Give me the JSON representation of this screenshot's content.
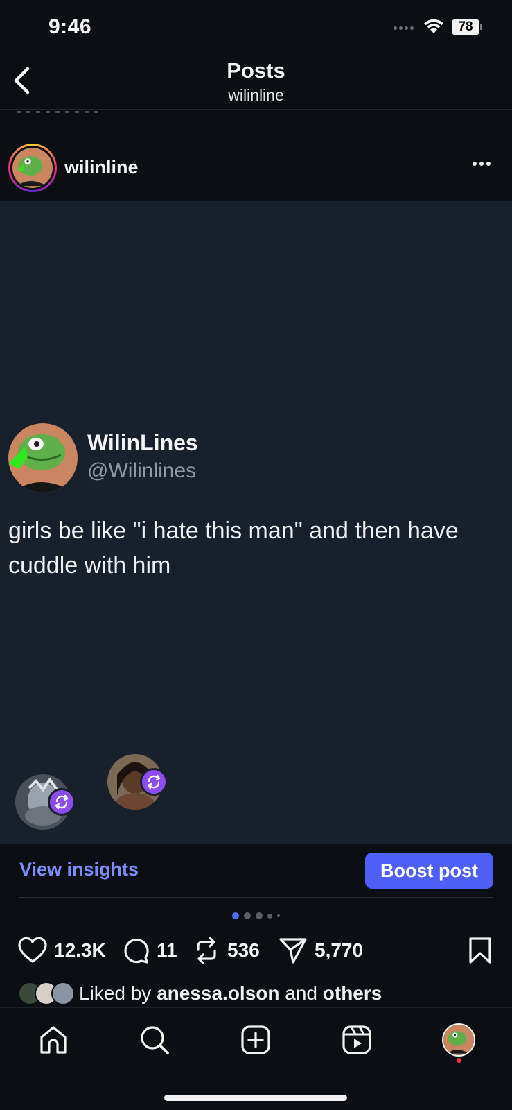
{
  "status_bar": {
    "time": "9:46",
    "battery": "78",
    "icons": [
      "signal-icon",
      "wifi-icon",
      "battery-icon"
    ]
  },
  "header": {
    "title": "Posts",
    "subtitle": "wilinline",
    "back_icon": "chevron-left-icon"
  },
  "post": {
    "username": "wilinline",
    "more_icon": "more-horizontal-icon",
    "tweet": {
      "display_name": "WilinLines",
      "handle": "@Wilinlines",
      "text": "girls be like \"i hate this man\" and then have cuddle with him"
    },
    "reposter_badges": [
      "repost-icon",
      "repost-icon"
    ]
  },
  "insights": {
    "view_label": "View insights",
    "boost_label": "Boost post"
  },
  "carousel": {
    "dots_total": 5,
    "active_index": 0
  },
  "actions": {
    "likes": "12.3K",
    "comments": "11",
    "reposts": "536",
    "shares": "5,770",
    "icons": [
      "heart-icon",
      "comment-icon",
      "repost-icon",
      "send-icon",
      "bookmark-icon"
    ]
  },
  "liked_by": {
    "prefix": "Liked by",
    "user": "anessa.olson",
    "joiner": "and",
    "others": "others"
  },
  "tab_bar": {
    "icons": [
      "home-icon",
      "search-icon",
      "create-icon",
      "reels-icon",
      "profile-avatar"
    ]
  },
  "colors": {
    "background": "#0b0e13",
    "media_background": "#17202b",
    "accent_link": "#7b8cff",
    "boost_button": "#4e5ff5",
    "repost_badge": "#8c4cf0",
    "notification_dot": "#ff3040"
  }
}
